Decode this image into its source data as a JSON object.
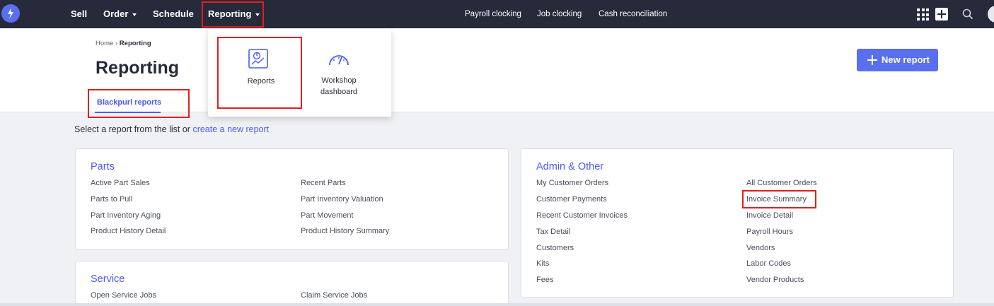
{
  "nav": {
    "items": [
      {
        "label": "Sell",
        "caret": false
      },
      {
        "label": "Order",
        "caret": true
      },
      {
        "label": "Schedule",
        "caret": false
      },
      {
        "label": "Reporting",
        "caret": true
      }
    ],
    "links": [
      "Payroll clocking",
      "Job clocking",
      "Cash reconciliation"
    ],
    "icons": [
      "logo-icon",
      "apps-grid-icon",
      "add-icon",
      "search-icon",
      "avatar"
    ]
  },
  "breadcrumb": {
    "home": "Home",
    "separator": "›",
    "current": "Reporting"
  },
  "page_title": "Reporting",
  "tabs": [
    {
      "label": "Blackpurl reports",
      "active": true
    }
  ],
  "new_report_button": "New report",
  "dropdown": {
    "items": [
      {
        "label": "Reports",
        "icon": "reports-icon"
      },
      {
        "label_line1": "Workshop",
        "label_line2": "dashboard",
        "icon": "gauge-icon"
      }
    ]
  },
  "intro": {
    "text": "Select a report from the list or ",
    "link": "create a new report"
  },
  "cards": {
    "parts": {
      "title": "Parts",
      "left": [
        "Active Part Sales",
        "Parts to Pull",
        "Part Inventory Aging",
        "Product History Detail"
      ],
      "right": [
        "Recent Parts",
        "Part Inventory Valuation",
        "Part Movement",
        "Product History Summary"
      ]
    },
    "service": {
      "title": "Service",
      "left": [
        "Open Service Jobs"
      ],
      "right": [
        "Claim Service Jobs"
      ]
    },
    "admin": {
      "title": "Admin & Other",
      "left": [
        "My Customer Orders",
        "Customer Payments",
        "Recent Customer Invoices",
        "Tax Detail",
        "Customers",
        "Kits",
        "Fees"
      ],
      "right": [
        "All Customer Orders",
        "Invoice Summary",
        "Invoice Detail",
        "Payroll Hours",
        "Vendors",
        "Labor Codes",
        "Vendor Products"
      ]
    }
  },
  "colors": {
    "nav_bg": "#262a3b",
    "accent": "#4a5cf0",
    "button": "#5a6ef0",
    "highlight": "#e02020"
  }
}
